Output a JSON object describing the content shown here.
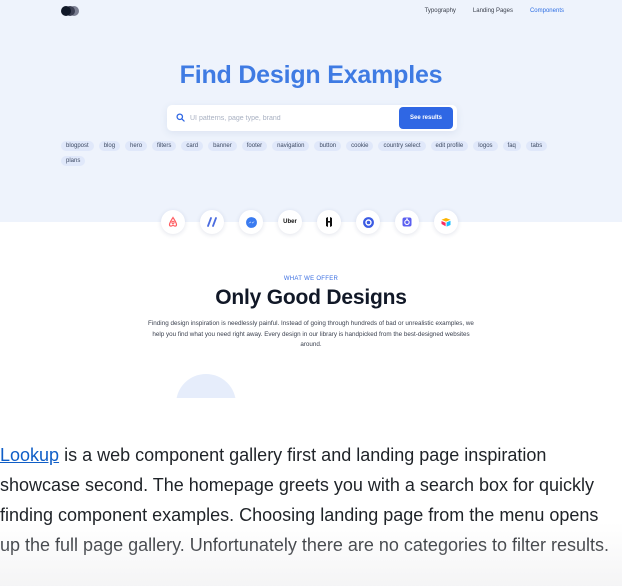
{
  "nav": {
    "links": [
      {
        "label": "Typography",
        "active": false
      },
      {
        "label": "Landing Pages",
        "active": false
      },
      {
        "label": "Components",
        "active": true
      }
    ]
  },
  "hero": {
    "title": "Find Design Examples",
    "search_placeholder": "UI patterns, page type, brand",
    "search_button": "See results",
    "tags": [
      "blogpost",
      "blog",
      "hero",
      "filters",
      "card",
      "banner",
      "footer",
      "navigation",
      "button",
      "cookie",
      "country select",
      "edit profile",
      "logos",
      "faq",
      "tabs",
      "plans"
    ]
  },
  "brands": {
    "items": [
      "airbnb-logo",
      "stripe-like-logo",
      "messenger-logo",
      "uber-logo",
      "hashicorp-logo",
      "pronounce-logo",
      "cron-logo",
      "airtable-logo"
    ],
    "uber_label": "Uber"
  },
  "offer": {
    "eyebrow": "WHAT WE OFFER",
    "title": "Only Good Designs",
    "body": "Finding design inspiration is needlessly painful. Instead of going through hundreds of bad or unrealistic examples, we help you find what you need right away. Every design in our library is handpicked from the best-designed websites around."
  },
  "caption": {
    "link_text": "Lookup",
    "text": " is a web component gallery first and landing page inspiration showcase second. The homepage greets you with a search box for quickly finding component examples. Choosing landing page from the menu opens up the full page gallery. Unfortunately there are no categories to filter results."
  },
  "colors": {
    "accent": "#2f67e4",
    "hero_title": "#3f7be3",
    "hero_bg": "#eef3fc",
    "tag_bg": "#e0e8fa",
    "link": "#0f5ec7"
  }
}
